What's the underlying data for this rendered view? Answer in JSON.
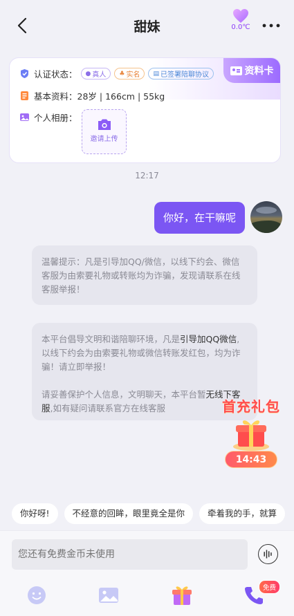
{
  "header": {
    "title": "甜妹",
    "temperature": "0.0℃"
  },
  "profile_card": {
    "tab_label": "资料卡",
    "verify_label": "认证状态：",
    "badges": [
      "真人",
      "实名",
      "已签署陪聊协议"
    ],
    "basic_label": "基本资料：",
    "basic_value": "28岁 | 166cm | 55kg",
    "album_label": "个人相册：",
    "upload_label": "邀请上传"
  },
  "time_divider": "12:17",
  "messages": {
    "me": "你好，在干嘛呢",
    "system1": "温馨提示：凡是引导加QQ/微信，以线下约会、微信客服为由索要礼物或转账均为诈骗，发现请联系在线客服举报！",
    "system2_p1_a": "本平台倡导文明和谐陪聊环境，凡是",
    "system2_p1_b": "引导加QQ微信",
    "system2_p1_c": ",以线下约会为由索要礼物或微信转账发红包，均为诈骗！请立即举报！",
    "system2_p2_a": "请妥善保护个人信息，文明聊天，本平台暂",
    "system2_p2_b": "无线下客服",
    "system2_p2_c": ",如有疑问请联系官方在线客服"
  },
  "gift": {
    "title": "首充礼包",
    "timer": "14:43"
  },
  "quick_replies": [
    "你好呀!",
    "不经意的回眸，眼里竟全是你",
    "牵着我的手，就算"
  ],
  "input": {
    "placeholder": "您还有免费金币未使用"
  },
  "toolbar": {
    "free_badge": "免费"
  }
}
